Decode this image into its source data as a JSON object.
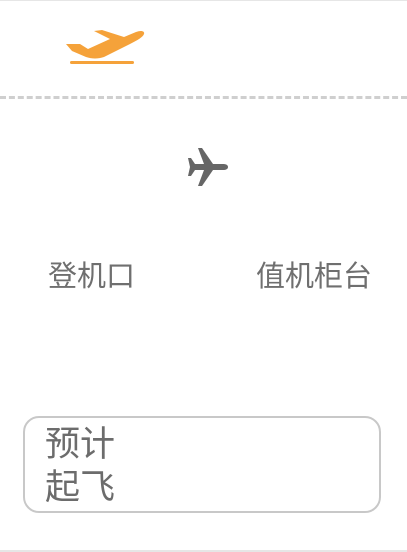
{
  "header": {
    "logo_icon": "departing-plane-icon",
    "logo_color": "#F5A23A"
  },
  "flight": {
    "icon": "airplane-icon",
    "icon_color": "#666666"
  },
  "info": {
    "gate_label": "登机口",
    "checkin_counter_label": "值机柜台"
  },
  "status": {
    "label": "预计起飞",
    "text_color": "#6C6C6C",
    "border_color": "#C8C8C8"
  }
}
